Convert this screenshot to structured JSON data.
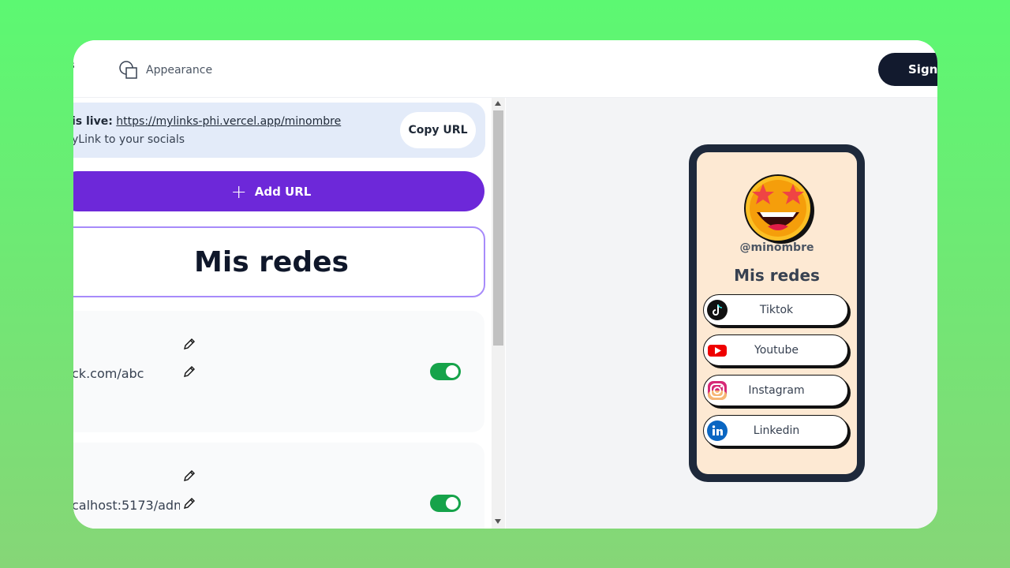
{
  "header": {
    "links_tab": "ks",
    "appearance_tab": "Appearance",
    "sign_button": "Sign \t"
  },
  "banner": {
    "live_prefix": "is live:",
    "live_url": "https://mylinks-phi.vercel.app/minombre",
    "share_text": "yLink to your socials",
    "copy_button": "Copy URL"
  },
  "add_url_button": "Add URL",
  "page_title": "Mis redes",
  "links": [
    {
      "url": "ck.com/abc",
      "enabled": true
    },
    {
      "url": "calhost:5173/adm",
      "enabled": true
    }
  ],
  "preview": {
    "username": "@minombre",
    "title": "Mis redes",
    "buttons": [
      {
        "label": "Tiktok",
        "icon": "tiktok-icon"
      },
      {
        "label": "Youtube",
        "icon": "youtube-icon"
      },
      {
        "label": "Instagram",
        "icon": "instagram-icon"
      },
      {
        "label": "Linkedin",
        "icon": "linkedin-icon"
      }
    ]
  },
  "colors": {
    "accent": "#6d28d9",
    "toggle_on": "#16a34a",
    "phone_bg": "#fde9d3"
  }
}
